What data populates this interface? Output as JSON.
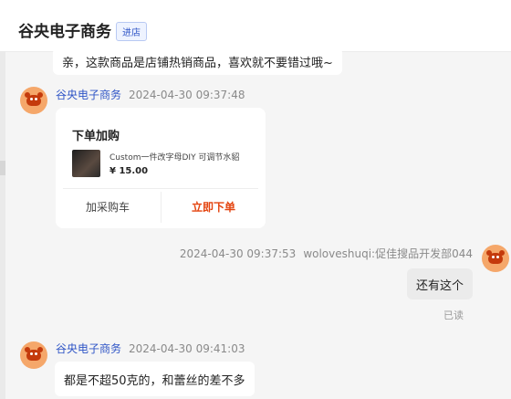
{
  "header": {
    "shop_name": "谷央电子商务",
    "enter_badge": "进店"
  },
  "messages": {
    "m1": {
      "text": "亲，这款商品是店铺热销商品，喜欢就不要错过哦~"
    },
    "m2": {
      "sender": "谷央电子商务",
      "time": "2024-04-30 09:37:48",
      "card": {
        "title": "下单加购",
        "product_name": "Custom一件改字母DIY 可调节水貂",
        "price": "¥ 15.00",
        "cart_button": "加采购车",
        "buy_button": "立即下单"
      }
    },
    "m3": {
      "time": "2024-04-30 09:37:53",
      "sender": "woloveshuqi:促佳搜品开发部044",
      "text": "还有这个",
      "status": "已读"
    },
    "m4": {
      "sender": "谷央电子商务",
      "time": "2024-04-30 09:41:03",
      "text": "都是不超50克的，和蕾丝的差不多"
    }
  },
  "colors": {
    "accent_blue": "#2f55c6",
    "buy_orange": "#e4440f",
    "avatar_bg": "#f5a76a"
  }
}
